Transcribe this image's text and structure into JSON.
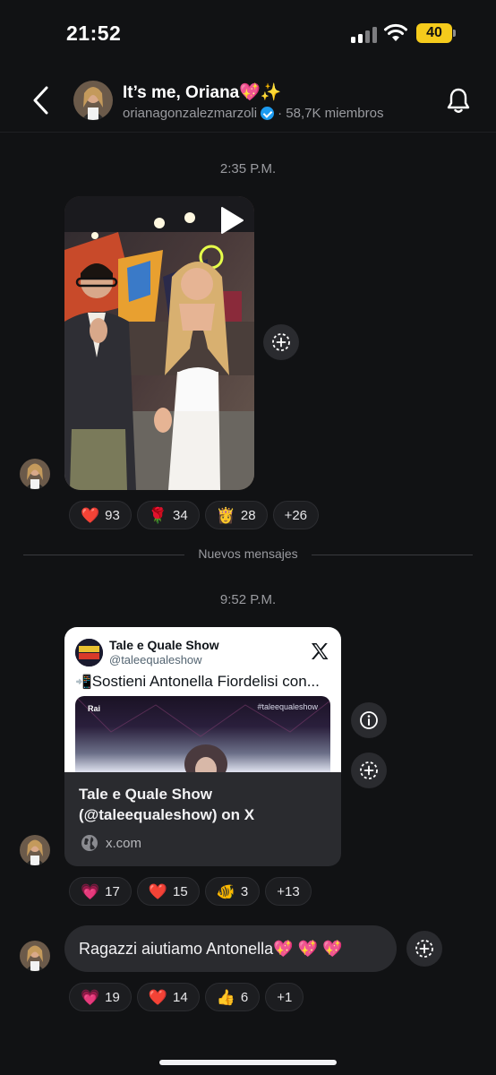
{
  "status_bar": {
    "time": "21:52",
    "battery": "40",
    "battery_color": "#f5cb1c"
  },
  "header": {
    "back_icon": "chevron-left-icon",
    "title": "It’s me, Oriana💖✨",
    "username": "orianagonzalezmarzoli",
    "members": "· 58,7K miembros",
    "bell_icon": "bell-icon"
  },
  "messages": [
    {
      "timestamp": "2:35 P.M.",
      "type": "video",
      "reactions": [
        {
          "emoji": "❤️",
          "count": "93"
        },
        {
          "emoji": "🌹",
          "count": "34"
        },
        {
          "emoji": "👸",
          "count": "28"
        },
        {
          "emoji": "",
          "count": "+26"
        }
      ]
    },
    {
      "timestamp": "9:52 P.M.",
      "type": "link",
      "card": {
        "account_name": "Tale e Quale Show",
        "account_handle": "@taleequaleshow",
        "tweet_emoji": "📲",
        "tweet_text": "Sostieni Antonella Fiordelisi con...",
        "image_tag": "#taleequaleshow",
        "image_brand": "Rai",
        "title": "Tale e Quale Show (@taleequaleshow) on X",
        "domain": "x.com"
      },
      "reactions": [
        {
          "emoji": "💗",
          "count": "17"
        },
        {
          "emoji": "❤️",
          "count": "15"
        },
        {
          "emoji": "🐠",
          "count": "3"
        },
        {
          "emoji": "",
          "count": "+13"
        }
      ]
    },
    {
      "type": "text",
      "text": "Ragazzi aiutiamo Antonella💖 💖 💖",
      "reactions": [
        {
          "emoji": "💗",
          "count": "19"
        },
        {
          "emoji": "❤️",
          "count": "14"
        },
        {
          "emoji": "👍",
          "count": "6"
        },
        {
          "emoji": "",
          "count": "+1"
        }
      ]
    }
  ],
  "divider_text": "Nuevos mensajes",
  "colors": {
    "background": "#111214",
    "bubble": "#2a2b2f",
    "verified": "#1d9bf0"
  }
}
